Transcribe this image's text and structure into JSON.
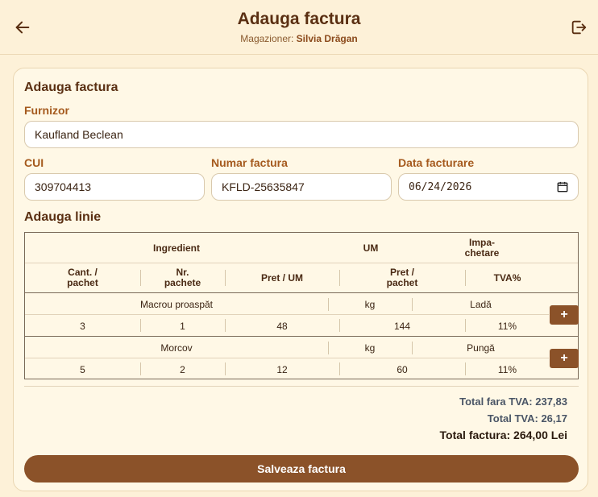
{
  "header": {
    "title": "Adauga factura",
    "subtitle_label": "Magazioner:",
    "subtitle_name": "Silvia Drăgan"
  },
  "form": {
    "card_title": "Adauga factura",
    "furnizor_label": "Furnizor",
    "furnizor_value": "Kaufland Beclean",
    "cui_label": "CUI",
    "cui_value": "309704413",
    "numar_label": "Numar factura",
    "numar_value": "KFLD-25635847",
    "data_label": "Data facturare",
    "data_value": "06/24/2026"
  },
  "lines": {
    "section_title": "Adauga linie",
    "headers": {
      "ingredient": "Ingredient",
      "um": "UM",
      "impachetare": "Impa-\nchetare",
      "cant": "Cant. /\npachet",
      "nr": "Nr.\npachete",
      "pret_um": "Pret / UM",
      "pret_pachet": "Pret /\npachet",
      "tva": "TVA%"
    },
    "rows": [
      {
        "ingredient": "Macrou proaspăt",
        "um": "kg",
        "impachetare": "Ladă",
        "cant": "3",
        "nr": "1",
        "pret_um": "48",
        "pret_pachet": "144",
        "tva": "11%",
        "add": "+"
      },
      {
        "ingredient": "Morcov",
        "um": "kg",
        "impachetare": "Pungă",
        "cant": "5",
        "nr": "2",
        "pret_um": "12",
        "pret_pachet": "60",
        "tva": "11%",
        "add": "+"
      }
    ]
  },
  "totals": {
    "fara_tva": "Total fara TVA: 237,83",
    "tva": "Total TVA: 26,17",
    "factura": "Total factura: 264,00 Lei"
  },
  "actions": {
    "save_label": "Salveaza factura"
  },
  "colors": {
    "background": "#fdf1d8",
    "accent": "#8b5229",
    "label": "#a55a1e"
  },
  "icons": {
    "back": "arrow-left-icon",
    "logout": "logout-icon",
    "calendar": "calendar-icon"
  }
}
